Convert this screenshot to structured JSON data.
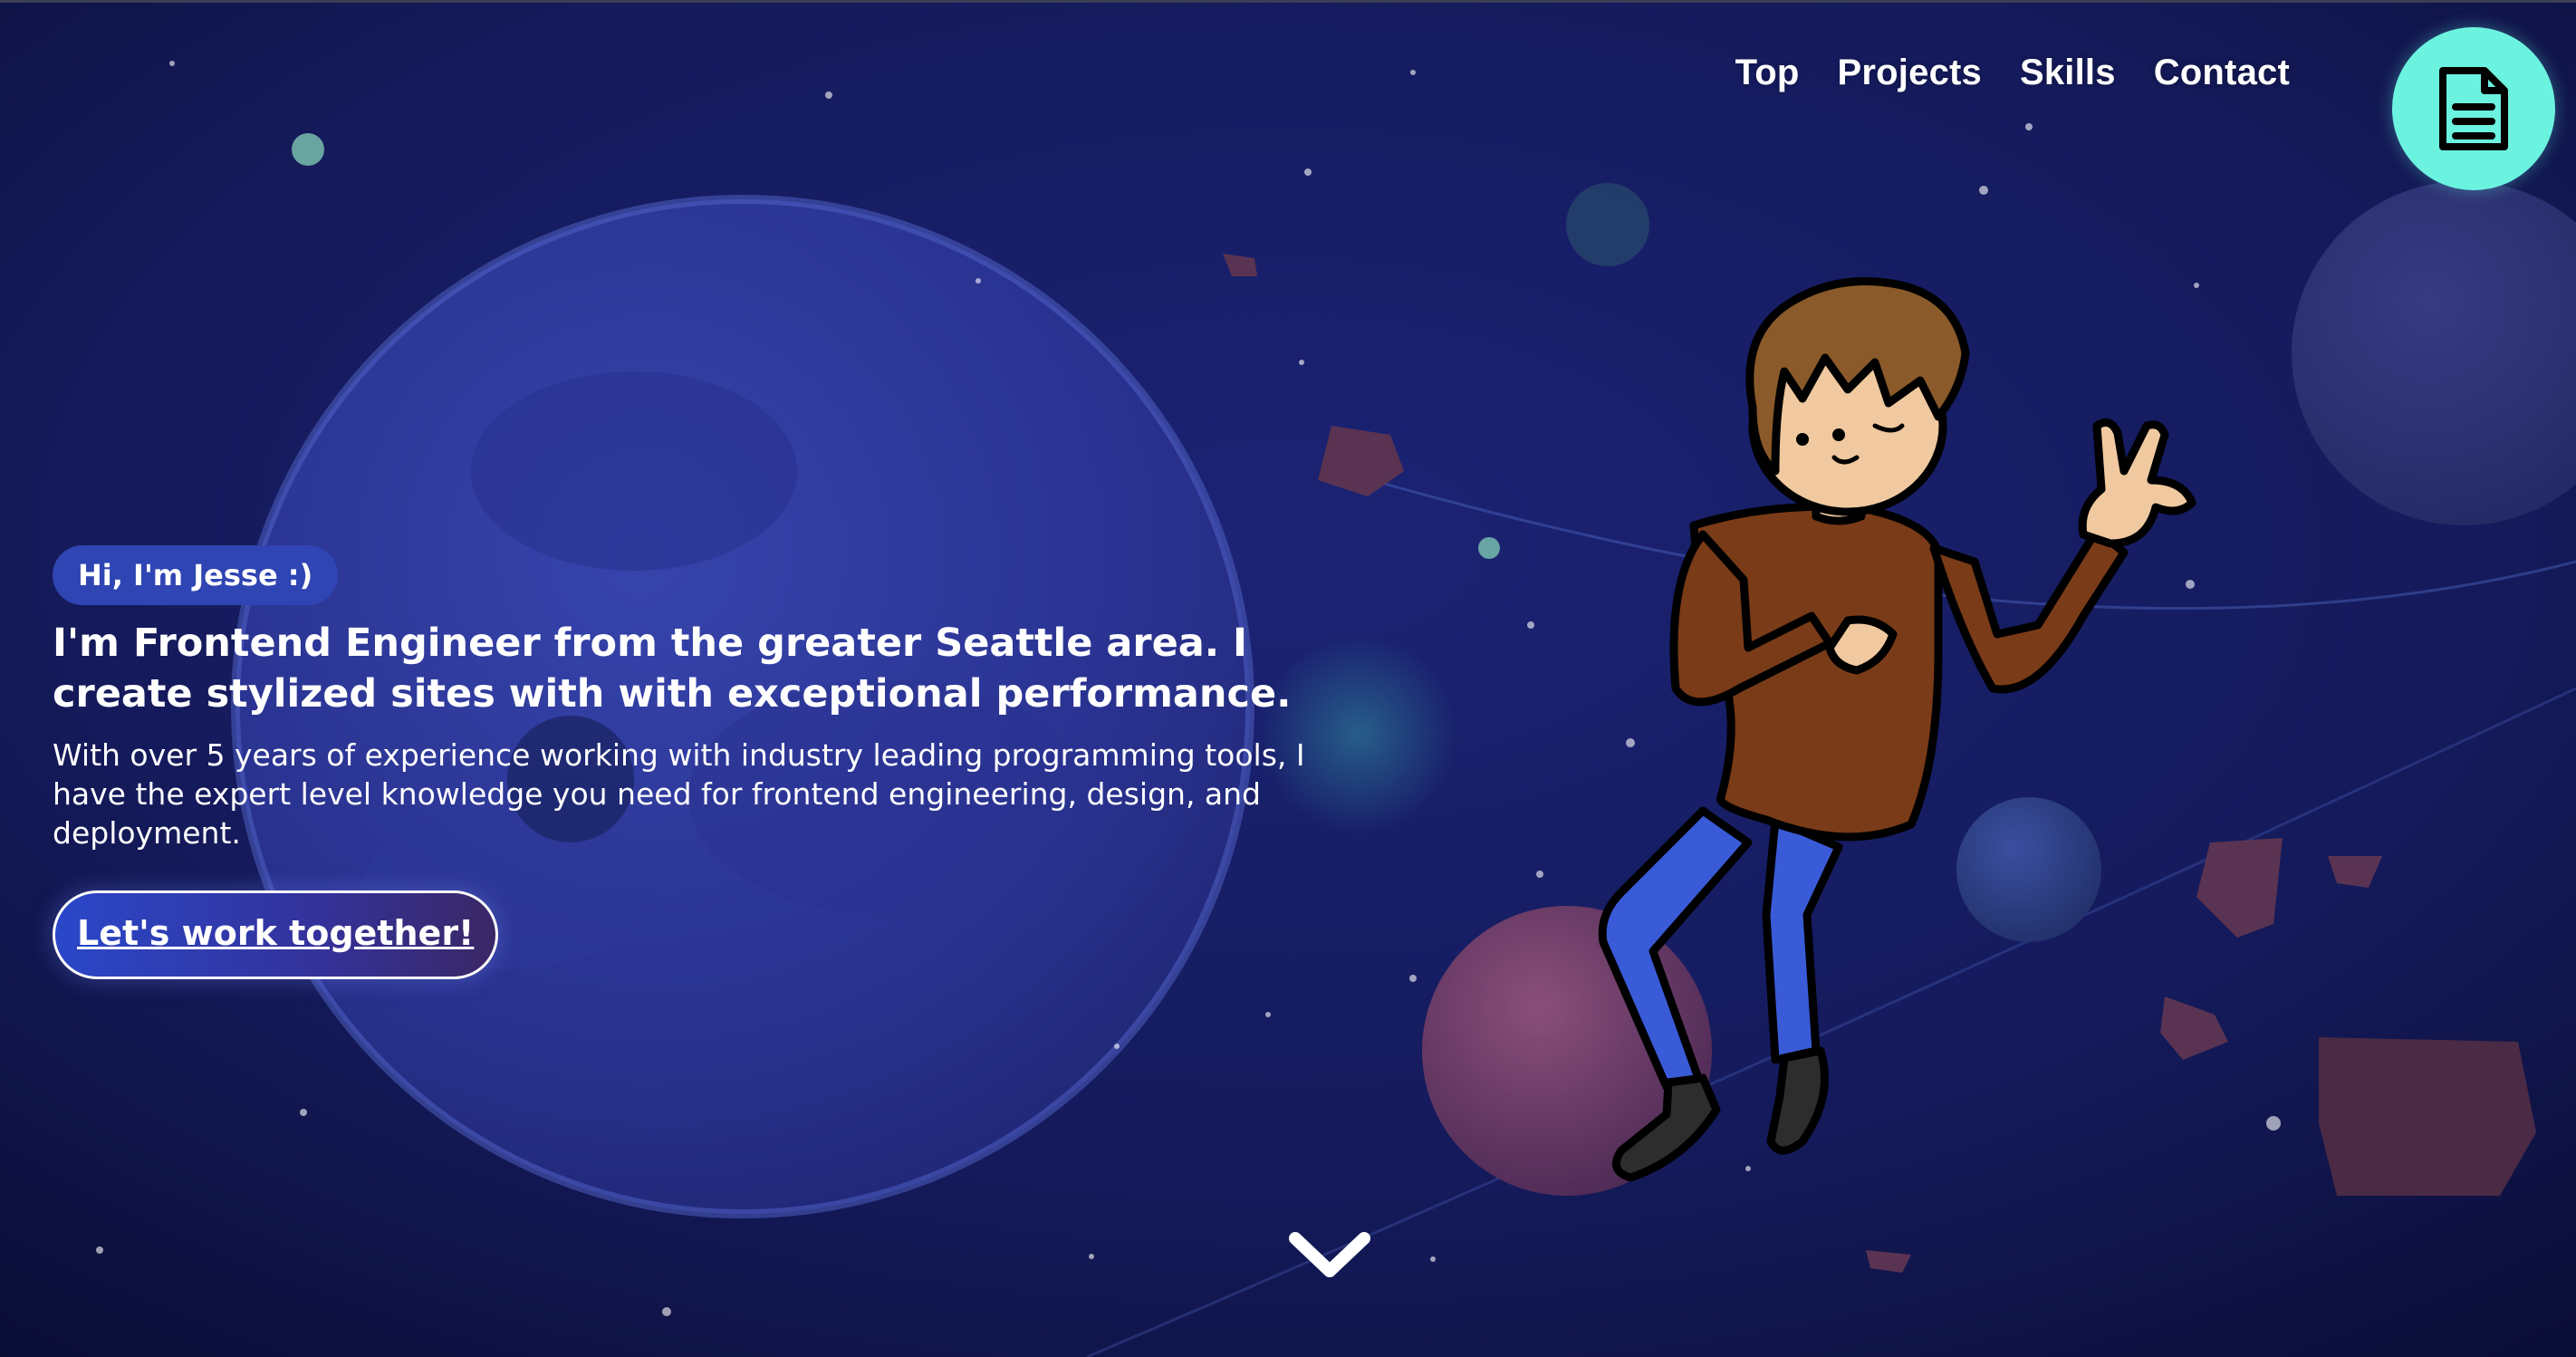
{
  "nav": {
    "items": [
      "Top",
      "Projects",
      "Skills",
      "Contact"
    ]
  },
  "resume_button": {
    "icon": "document-icon"
  },
  "hero": {
    "greeting": "Hi, I'm Jesse :)",
    "headline": "I'm Frontend Engineer from the greater Seattle area. I create stylized sites with with exceptional performance.",
    "subtext": "With over 5 years of experience working with industry leading programming tools, I have the expert level knowledge you need for frontend engineering, design, and deployment.",
    "cta_label": "Let's work together!"
  },
  "scroll": {
    "icon": "chevron-down-icon"
  },
  "colors": {
    "background": "#0e1240",
    "accent": "#6cf3e0",
    "badge": "#2f45b3",
    "shirt": "#7a3b18",
    "pants": "#3a5bd8"
  }
}
